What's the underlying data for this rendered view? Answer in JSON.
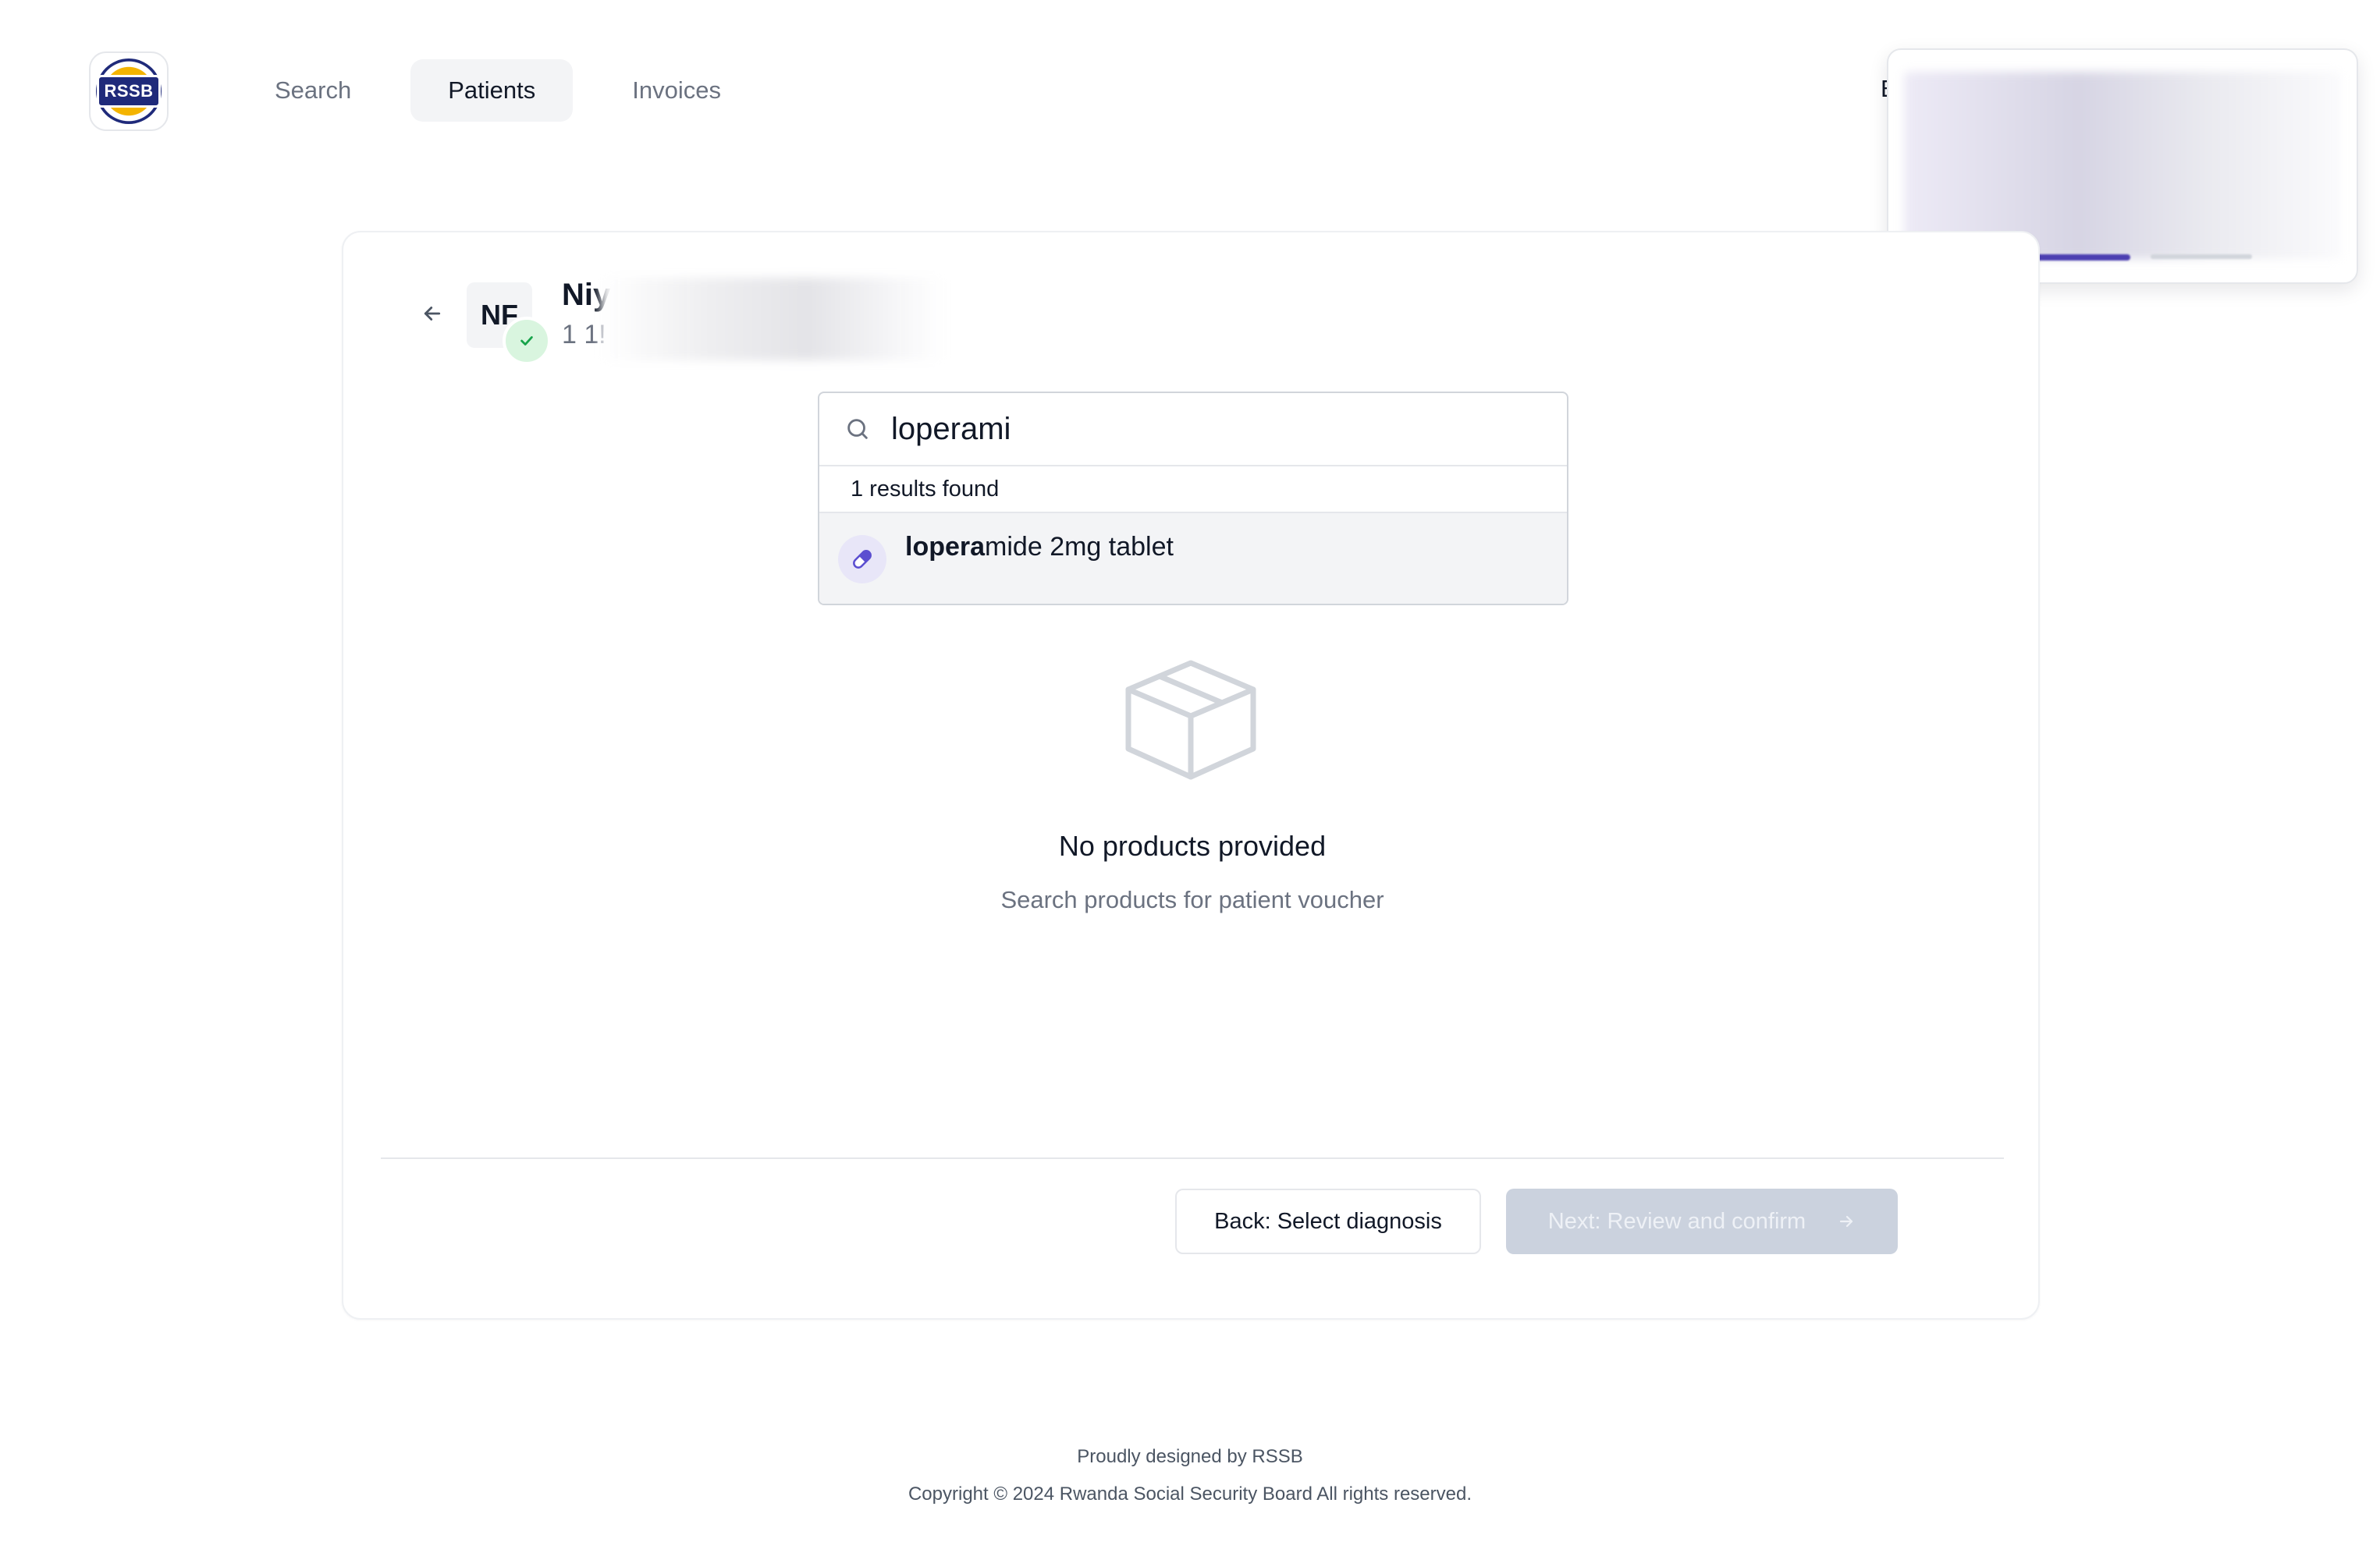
{
  "header": {
    "logo_text": "RSSB",
    "nav": [
      {
        "label": "Search"
      },
      {
        "label": "Patients"
      },
      {
        "label": "Invoices"
      }
    ],
    "right_partial_text": "E"
  },
  "patient": {
    "initials": "NF",
    "name_visible": "Niy",
    "id_visible": "1 1!"
  },
  "search": {
    "value": "loperami",
    "results_count": "1 results found",
    "result": {
      "match": "lopera",
      "rest": "mide 2mg tablet"
    }
  },
  "empty_state": {
    "title": "No products provided",
    "subtitle": "Search products for patient voucher"
  },
  "actions": {
    "back_label": "Back: Select diagnosis",
    "next_label": "Next: Review and confirm"
  },
  "footer": {
    "line1": "Proudly designed by RSSB",
    "line2": "Copyright © 2024 Rwanda Social Security Board All rights reserved."
  },
  "icons": {
    "back": "arrow-left-icon",
    "verified": "check-icon",
    "search": "search-icon",
    "pill": "pill-icon",
    "empty": "box-icon",
    "next": "arrow-right-icon"
  },
  "colors": {
    "active_nav_bg": "#f3f4f6",
    "verified_bg": "#d9f5df",
    "verified_fg": "#16a34a",
    "pill_accent": "#5b4ed0",
    "next_disabled_bg": "#cbd2de"
  }
}
